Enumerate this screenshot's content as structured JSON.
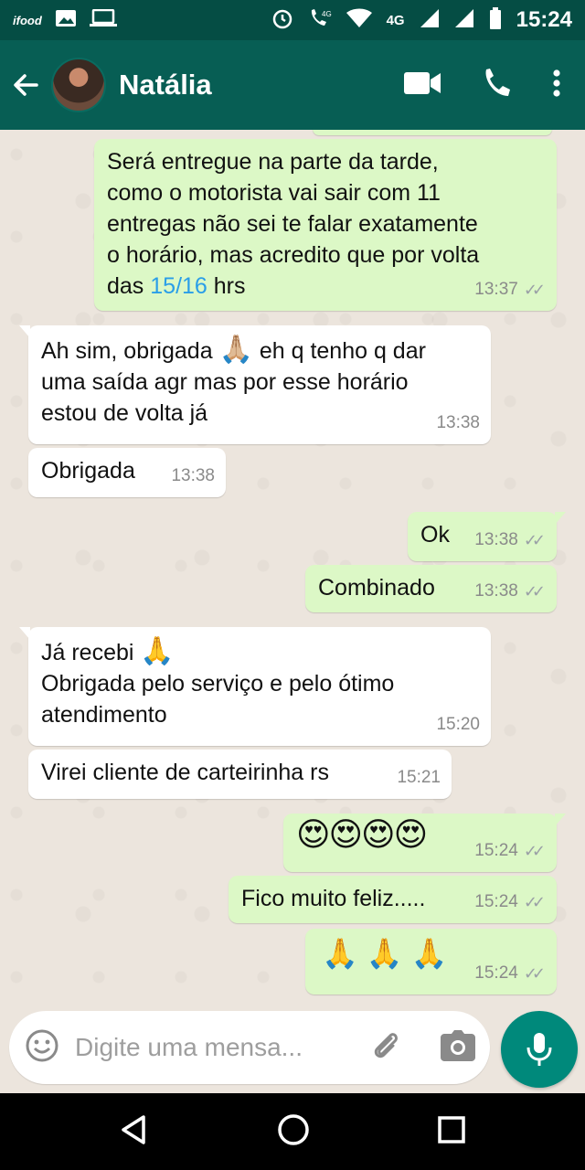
{
  "status_bar": {
    "left_items": [
      "ifood",
      "image-icon",
      "laptop-icon"
    ],
    "network_label": "4G",
    "time": "15:24"
  },
  "header": {
    "contact_name": "Natália",
    "icons": [
      "back-arrow-icon",
      "video-call-icon",
      "phone-icon",
      "more-vertical-icon"
    ]
  },
  "messages": [
    {
      "direction": "out",
      "lines": [
        "Será entregue na parte da tarde,",
        "como o motorista vai sair com 11",
        "entregas não sei te falar exatamente",
        "o horário, mas acredito que por volta"
      ],
      "last_prefix": "das ",
      "last_link": "15/16",
      "last_suffix": " hrs",
      "time": "13:37",
      "ticks": "✓✓"
    },
    {
      "direction": "in",
      "line1_text": "Ah sim, obrigada ",
      "line1_emoji": "🙏🏼",
      "line1_suffix": " eh q tenho q dar",
      "line2": "uma saída agr mas por esse horário",
      "line3": "estou de volta já",
      "time": "13:38"
    },
    {
      "direction": "in",
      "text": "Obrigada",
      "time": "13:38"
    },
    {
      "direction": "out",
      "text": "Ok",
      "time": "13:38",
      "ticks": "✓✓"
    },
    {
      "direction": "out",
      "text": "Combinado",
      "time": "13:38",
      "ticks": "✓✓"
    },
    {
      "direction": "in",
      "line1_text": "Já recebi ",
      "line1_emoji": "🙏",
      "line2": "Obrigada pelo serviço e pelo ótimo",
      "line3": "atendimento",
      "time": "15:20"
    },
    {
      "direction": "in",
      "text": "Virei cliente de carteirinha rs",
      "time": "15:21"
    },
    {
      "direction": "out",
      "text": "😍😍😍😍",
      "time": "15:24",
      "ticks": "✓✓"
    },
    {
      "direction": "out",
      "text": "Fico muito feliz.....",
      "time": "15:24",
      "ticks": "✓✓"
    },
    {
      "direction": "out",
      "text": "🙏 🙏 🙏",
      "time": "15:24",
      "ticks": "✓✓"
    }
  ],
  "composer": {
    "placeholder": "Digite uma mensa...",
    "icons": [
      "emoji-icon",
      "attach-icon",
      "camera-icon",
      "mic-icon"
    ]
  },
  "colors": {
    "status_bar": "#054d44",
    "header": "#075e54",
    "outgoing_bubble": "#dcf8c6",
    "incoming_bubble": "#ffffff",
    "link": "#2a9ee8",
    "mic_button": "#00897b"
  }
}
